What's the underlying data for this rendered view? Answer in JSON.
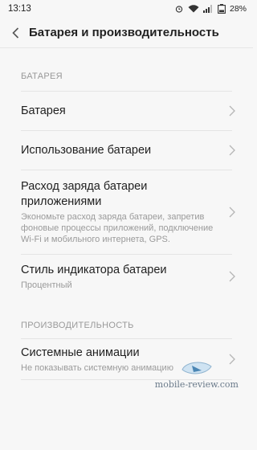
{
  "status_bar": {
    "time": "13:13",
    "battery_percent": "28%"
  },
  "header": {
    "title": "Батарея и производительность"
  },
  "sections": [
    {
      "label": "БАТАРЕЯ",
      "items": [
        {
          "title": "Батарея"
        },
        {
          "title": "Использование батареи"
        },
        {
          "title": "Расход заряда батареи приложениями",
          "subtitle": "Экономьте расход заряда батареи, запретив фоновые процессы приложений, подключение Wi-Fi и мобильного интернета, GPS."
        },
        {
          "title": "Стиль индикатора батареи",
          "subtitle": "Процентный"
        }
      ]
    },
    {
      "label": "ПРОИЗВОДИТЕЛЬНОСТЬ",
      "items": [
        {
          "title": "Системные анимации",
          "subtitle": "Не показывать системную анимацию"
        }
      ]
    }
  ],
  "watermark": {
    "text": "mobile-review.com"
  },
  "icons": [
    "back-arrow-icon",
    "wifi-icon",
    "signal-icon",
    "battery-icon",
    "chevron-right-icon"
  ]
}
